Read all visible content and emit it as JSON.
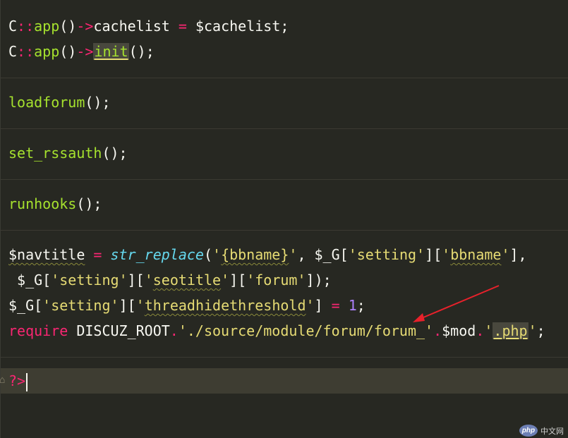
{
  "code": {
    "line1": {
      "cls": "C",
      "sep": "::",
      "fn": "app",
      "parens": "()",
      "arrow": "->",
      "prop": "cachelist",
      "eq": "=",
      "var": "$cachelist;"
    },
    "line2": {
      "cls": "C",
      "sep": "::",
      "fn": "app",
      "parens": "()",
      "arrow": "->",
      "method": "init",
      "tail": "();"
    },
    "line3": {
      "fn": "loadforum",
      "tail": "();"
    },
    "line4": {
      "fn": "set_rssauth",
      "tail": "();"
    },
    "line5": {
      "fn": "runhooks",
      "tail": "();"
    },
    "line6": {
      "var": "$navtitle",
      "eq": "=",
      "fn": "str_replace",
      "open": "(",
      "q1": "'",
      "s1": "{bbname}",
      "q1e": "'",
      "mid": ", $_G[",
      "q2": "'",
      "s2": "setting",
      "q2e": "'",
      "br": "][",
      "q3": "'",
      "s3": "bbname",
      "q3e": "'",
      "end": "],"
    },
    "line7": {
      "pre": " $_G[",
      "q1": "'",
      "s1": "setting",
      "q1e": "'",
      "br1": "][",
      "q2": "'",
      "s2": "seotitle",
      "q2e": "'",
      "br2": "][",
      "q3": "'",
      "s3": "forum",
      "q3e": "'",
      "end": "]);"
    },
    "line8": {
      "pre": "$_G[",
      "q1": "'",
      "s1": "setting",
      "q1e": "'",
      "br": "][",
      "q2": "'",
      "s2": "threadhidethreshold",
      "q2e": "'",
      "close": "]",
      "eq": "=",
      "num": "1",
      "semi": ";"
    },
    "line9": {
      "kw": "require",
      "const": "DISCUZ_ROOT",
      "dot1": ".",
      "q1": "'",
      "s1": "./source/module/forum/forum_",
      "q1e": "'",
      "dot2": ".",
      "var": "$mod",
      "dot3": ".",
      "q2": "'",
      "s2": ".php",
      "q2e": "'",
      "semi": ";"
    },
    "line10": {
      "tag": "?>"
    }
  },
  "colors": {
    "background": "#272822",
    "current_line": "#3e3d32",
    "keyword": "#f92672",
    "function": "#a6e22e",
    "string": "#e6db74",
    "number": "#ae81ff",
    "builtin": "#66d9ef",
    "annotation_arrow": "#e8212b"
  },
  "watermark": {
    "badge": "php",
    "text": "中文网"
  }
}
